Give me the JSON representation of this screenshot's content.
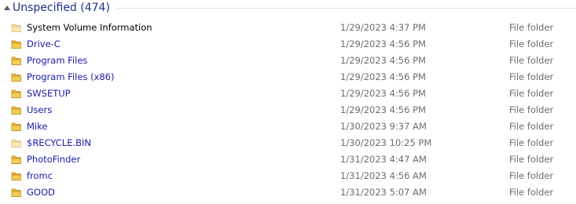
{
  "group": {
    "title": "Unspecified (474)"
  },
  "items": [
    {
      "name": "System Volume Information",
      "date": "1/29/2023 4:37 PM",
      "type": "File folder",
      "hidden": true
    },
    {
      "name": "Drive-C",
      "date": "1/29/2023 4:56 PM",
      "type": "File folder",
      "hidden": false
    },
    {
      "name": "Program Files",
      "date": "1/29/2023 4:56 PM",
      "type": "File folder",
      "hidden": false
    },
    {
      "name": "Program Files (x86)",
      "date": "1/29/2023 4:56 PM",
      "type": "File folder",
      "hidden": false
    },
    {
      "name": "SWSETUP",
      "date": "1/29/2023 4:56 PM",
      "type": "File folder",
      "hidden": false
    },
    {
      "name": "Users",
      "date": "1/29/2023 4:56 PM",
      "type": "File folder",
      "hidden": false
    },
    {
      "name": "Mike",
      "date": "1/30/2023 9:37 AM",
      "type": "File folder",
      "hidden": false
    },
    {
      "name": "$RECYCLE.BIN",
      "date": "1/30/2023 10:25 PM",
      "type": "File folder",
      "hidden": true
    },
    {
      "name": "PhotoFinder",
      "date": "1/31/2023 4:47 AM",
      "type": "File folder",
      "hidden": false
    },
    {
      "name": "fromc",
      "date": "1/31/2023 4:56 AM",
      "type": "File folder",
      "hidden": false
    },
    {
      "name": "GOOD",
      "date": "1/31/2023 5:07 AM",
      "type": "File folder",
      "hidden": false
    }
  ],
  "colors": {
    "group_title": "#1e3287",
    "item_link": "#1a1aa6",
    "item_system": "#000000",
    "meta_text": "#6d6d6d",
    "folder_fill": "#e8b838",
    "folder_fill_faded": "#f3dc9a"
  },
  "icons": {
    "group_toggle": "collapse-triangle-icon",
    "item": "folder-icon"
  }
}
